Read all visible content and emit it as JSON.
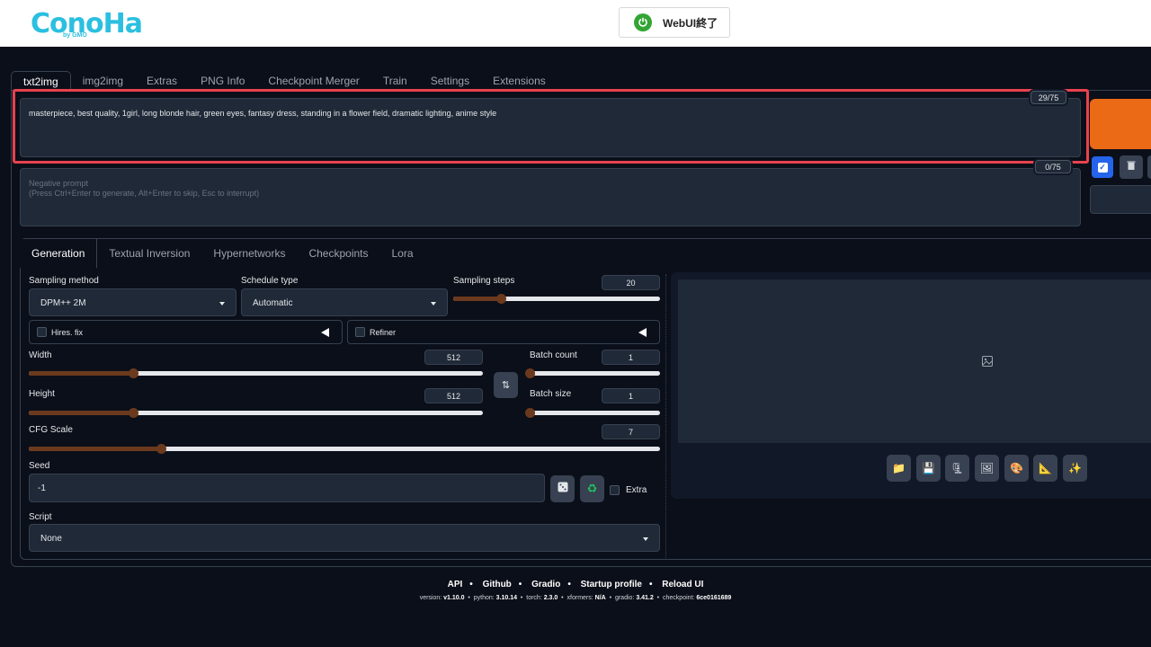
{
  "header": {
    "logo_text": "ConoHa",
    "logo_sub": "by GMO",
    "webui_button_label": "WebUI終了"
  },
  "tabs": [
    "txt2img",
    "img2img",
    "Extras",
    "PNG Info",
    "Checkpoint Merger",
    "Train",
    "Settings",
    "Extensions"
  ],
  "prompt": {
    "value": "masterpiece, best quality, 1girl, long blonde hair, green eyes, fantasy dress, standing in a flower field, dramatic lighting, anime style",
    "token_count": "29/75"
  },
  "negative_prompt": {
    "placeholder_line1": "Negative prompt",
    "placeholder_line2": "(Press Ctrl+Enter to generate, Alt+Enter to skip, Esc to interrupt)",
    "token_count": "0/75"
  },
  "sub_tabs": [
    "Generation",
    "Textual Inversion",
    "Hypernetworks",
    "Checkpoints",
    "Lora"
  ],
  "generation": {
    "sampling_method_label": "Sampling method",
    "sampling_method_value": "DPM++ 2M",
    "schedule_type_label": "Schedule type",
    "schedule_type_value": "Automatic",
    "sampling_steps_label": "Sampling steps",
    "sampling_steps_value": "20",
    "sampling_steps_fraction": 0.23,
    "hires_fix_label": "Hires. fix",
    "refiner_label": "Refiner",
    "width_label": "Width",
    "width_value": "512",
    "width_fraction": 0.23,
    "height_label": "Height",
    "height_value": "512",
    "height_fraction": 0.23,
    "batch_count_label": "Batch count",
    "batch_count_value": "1",
    "batch_count_fraction": 0.0,
    "batch_size_label": "Batch size",
    "batch_size_value": "1",
    "batch_size_fraction": 0.0,
    "cfg_scale_label": "CFG Scale",
    "cfg_scale_value": "7",
    "cfg_scale_fraction": 0.21,
    "seed_label": "Seed",
    "seed_value": "-1",
    "extra_label": "Extra",
    "script_label": "Script",
    "script_value": "None"
  },
  "footer": {
    "links": [
      "API",
      "Github",
      "Gradio",
      "Startup profile",
      "Reload UI"
    ],
    "version_items": [
      {
        "k": "version: ",
        "v": "v1.10.0"
      },
      {
        "k": "python: ",
        "v": "3.10.14"
      },
      {
        "k": "torch: ",
        "v": "2.3.0"
      },
      {
        "k": "xformers: ",
        "v": "N/A"
      },
      {
        "k": "gradio: ",
        "v": "3.41.2"
      },
      {
        "k": "checkpoint: ",
        "v": "6ce0161689"
      }
    ]
  },
  "colors": {
    "accent_generate": "#ea6a16",
    "highlight_box": "#e8424e",
    "slider_fill": "#6b3a1e",
    "background": "#0b0f19"
  }
}
